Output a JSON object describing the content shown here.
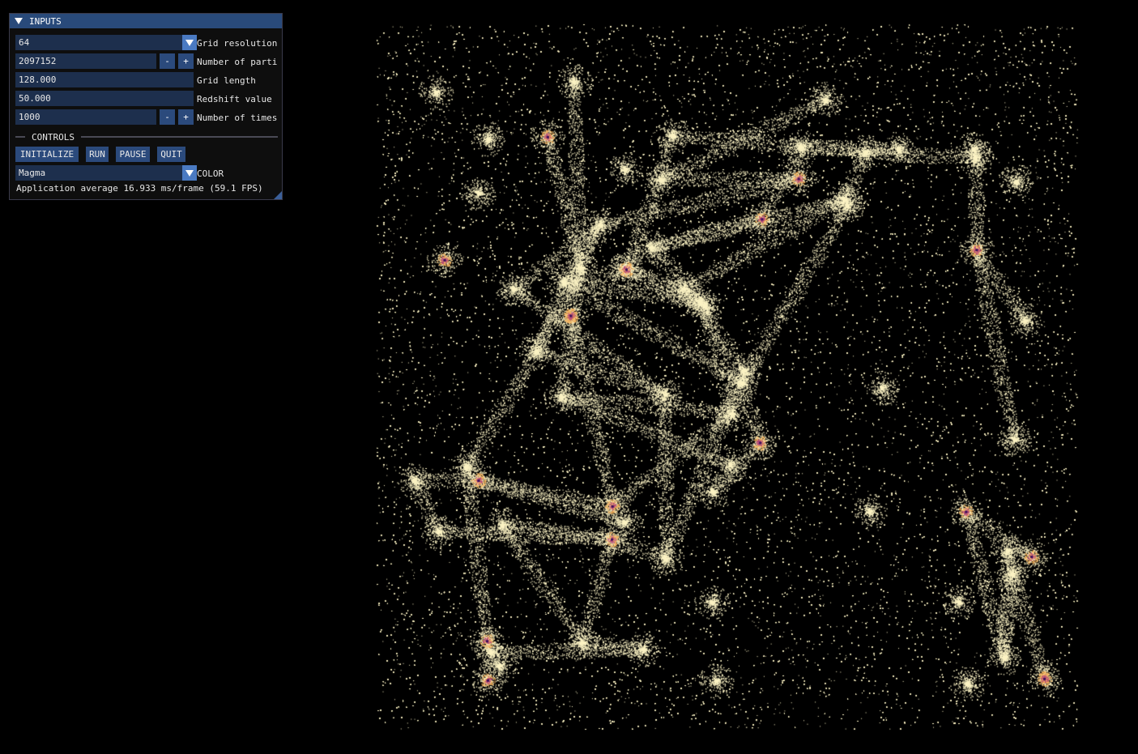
{
  "window": {
    "title": "INPUTS"
  },
  "inputs": {
    "grid_resolution": {
      "value": "64",
      "label": "Grid resolution"
    },
    "num_particles": {
      "value": "2097152",
      "label": "Number of parti",
      "minus": "-",
      "plus": "+"
    },
    "grid_length": {
      "value": "128.000",
      "label": "Grid length"
    },
    "redshift": {
      "value": "50.000",
      "label": "Redshift value"
    },
    "num_timesteps": {
      "value": "1000",
      "label": "Number of times",
      "minus": "-",
      "plus": "+"
    }
  },
  "controls": {
    "header": "CONTROLS",
    "initialize": "INITIALIZE",
    "run": "RUN",
    "pause": "PAUSE",
    "quit": "QUIT",
    "color_value": "Magma",
    "color_label": "COLOR"
  },
  "status": {
    "text": "Application average 16.933 ms/frame (59.1 FPS)"
  },
  "colors": {
    "background": "#000000",
    "particle_main": "#fcf3c4",
    "particle_warm": "#f6b15a",
    "particle_hot": "#b1437a",
    "particle_core": "#3b1058",
    "titlebar": "#294a7a",
    "button": "#2b4a7c",
    "field": "#1d2f4d"
  },
  "icons": {
    "collapse": "collapse-arrow-icon",
    "combo": "chevron-down-icon"
  }
}
